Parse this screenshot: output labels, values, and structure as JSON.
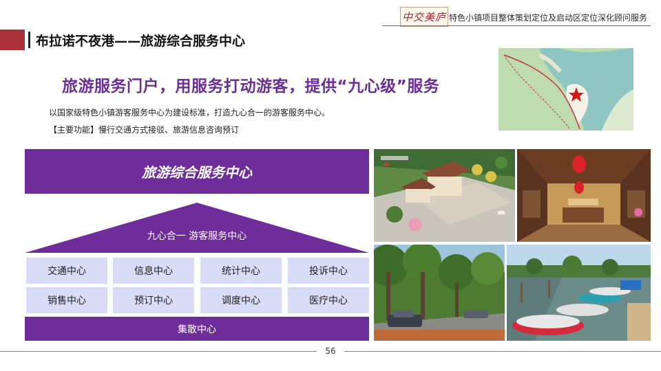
{
  "header": {
    "brand_calligraphy": "中交美庐",
    "brand_title": "特色小镇项目整体策划定位及启动区定位深化顾问服务"
  },
  "page_title": "布拉诺不夜港——旅游综合服务中心",
  "headline": "旅游服务门户，用服务打动游客，提供“九心级”服务",
  "description": {
    "line1": "以国家级特色小镇游客服务中心为建设标准，打造九心合一的游客服务中心。",
    "line2": "【主要功能】慢行交通方式接驳、旅游信息咨询预订"
  },
  "diagram": {
    "header": "旅游综合服务中心",
    "pyramid_label": "九心合一 游客服务中心",
    "row1": [
      "交通中心",
      "信息中心",
      "统计中心",
      "投诉中心"
    ],
    "row2": [
      "销售中心",
      "预订中心",
      "调度中心",
      "医疗中心"
    ],
    "footer": "集散中心"
  },
  "colors": {
    "accent_purple": "#6f2d9c",
    "cell_lavender": "#d9dcf7",
    "title_red": "#a8313c"
  },
  "page_number": "56"
}
